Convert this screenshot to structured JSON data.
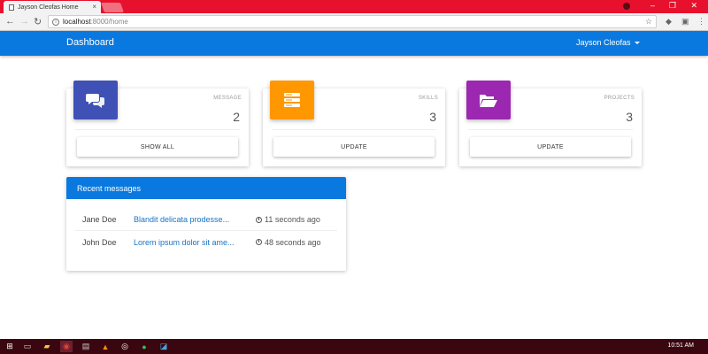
{
  "browser": {
    "tab_title": "Jayson Cleofas Home",
    "url_host": "localhost",
    "url_path": ":8000/home"
  },
  "app": {
    "brand": "Dashboard",
    "user": "Jayson Cleofas"
  },
  "cards": [
    {
      "category": "MESSAGE",
      "count": "2",
      "button": "SHOW ALL",
      "icon": "chat-bubbles-icon",
      "color": "#3f51b5"
    },
    {
      "category": "SKILLS",
      "count": "3",
      "button": "UPDATE",
      "icon": "server-stack-icon",
      "color": "#ff9800"
    },
    {
      "category": "PROJECTS",
      "count": "3",
      "button": "UPDATE",
      "icon": "folder-open-icon",
      "color": "#9c27b0"
    }
  ],
  "recent": {
    "title": "Recent messages",
    "rows": [
      {
        "sender": "Jane Doe",
        "snippet": "Blandit delicata prodesse...",
        "time": "11 seconds ago"
      },
      {
        "sender": "John Doe",
        "snippet": "Lorem ipsum dolor sit ame...",
        "time": "48 seconds ago"
      }
    ]
  },
  "taskbar": {
    "clock": "10:51 AM"
  },
  "colors": {
    "primary": "#0a79df",
    "chrome_red": "#e8112d"
  }
}
